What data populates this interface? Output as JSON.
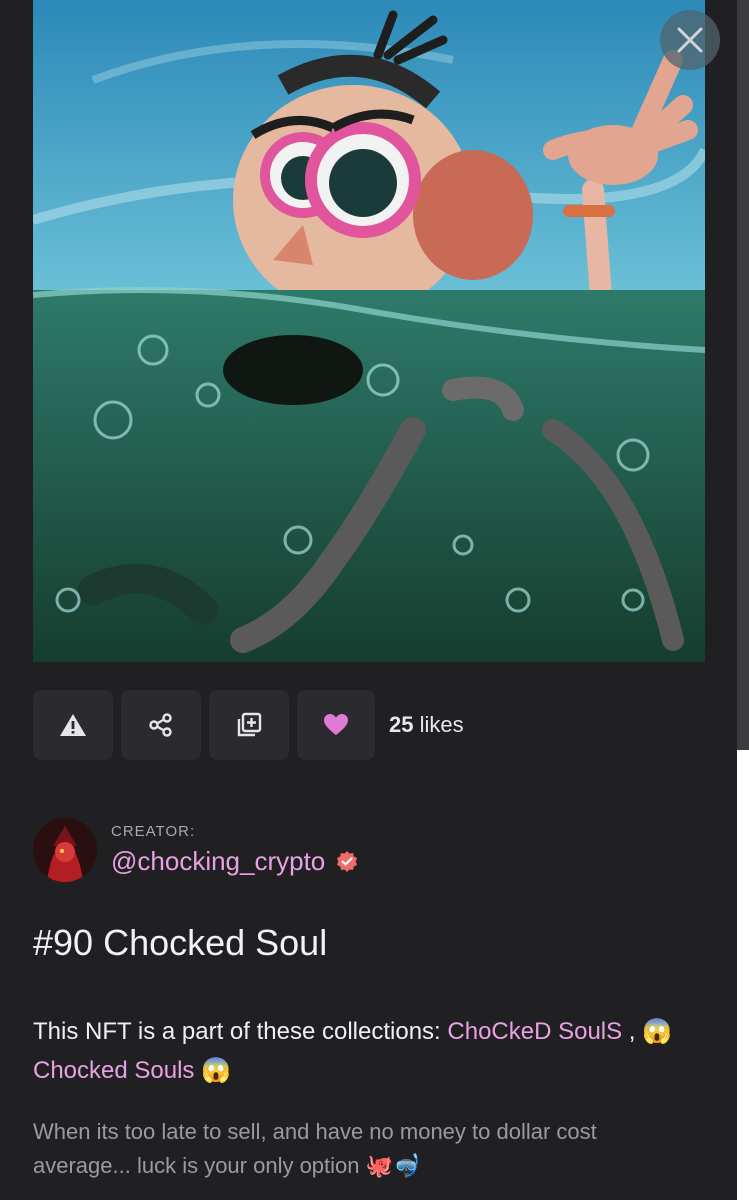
{
  "actions": {
    "likes_count": "25",
    "likes_label": "likes"
  },
  "creator": {
    "label": "CREATOR:",
    "handle": "@chocking_crypto"
  },
  "nft": {
    "title": "#90 Chocked Soul",
    "collections_prefix": "This NFT is a part of these collections:",
    "collection_1": "ChoCkeD SoulS",
    "separator": " ,",
    "collection_2": "😱 Chocked Souls 😱",
    "description": "When its too late to sell, and have no money to dollar cost average... luck is your only option 🐙🤿"
  },
  "colors": {
    "accent": "#e9a1e3",
    "heart": "#e07ad6",
    "verified": "#f26b6b",
    "background": "#202023"
  },
  "icons": [
    "close-icon",
    "warning-icon",
    "share-icon",
    "add-to-collection-icon",
    "heart-icon",
    "verified-icon"
  ]
}
